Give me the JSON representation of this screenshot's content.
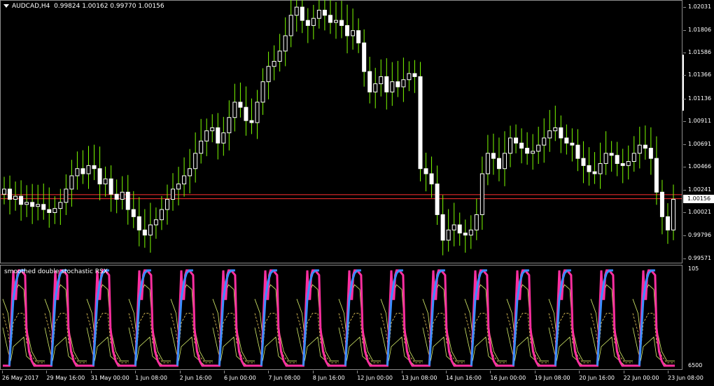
{
  "header": {
    "symbol": "AUDCAD,H4",
    "ohlc": "0.99824 1.00162 0.99770 1.00156"
  },
  "price_axis": {
    "labels": [
      "1.02031",
      "1.01806",
      "1.01586",
      "1.01366",
      "1.01136",
      "1.00911",
      "1.00691",
      "1.00466",
      "1.00241",
      "1.00021",
      "0.99796",
      "0.99571"
    ],
    "current": "1.00156",
    "current_value": 1.00156,
    "red_line_value": 1.00195
  },
  "indicator": {
    "name": "smoothed double stochastic RSX",
    "level_top": "105",
    "level_bottom": "-5",
    "level_bottom_label": "6500"
  },
  "time_axis": {
    "labels": [
      "26 May 2017",
      "29 May 16:00",
      "31 May 00:00",
      "1 Jun 08:00",
      "2 Jun 16:00",
      "6 Jun 00:00",
      "7 Jun 08:00",
      "8 Jun 16:00",
      "12 Jun 00:00",
      "13 Jun 08:00",
      "14 Jun 16:00",
      "16 Jun 00:00",
      "19 Jun 08:00",
      "20 Jun 16:00",
      "22 Jun 00:00",
      "23 Jun 08:00"
    ]
  },
  "colors": {
    "background": "#000000",
    "bull_candle": "#ffffff",
    "bear_candle": "#ffffff",
    "wick": "#7cfc00",
    "current_line": "#ff3030",
    "blue_line": "#3a8eff",
    "pink_line": "#ff2fa0",
    "band_line": "#d8f06a",
    "mid_dash": "#f0d060"
  },
  "chart_data": {
    "type": "candlestick",
    "x_range": [
      0,
      120
    ],
    "ylim": [
      0.99571,
      1.02031
    ],
    "open": [
      1.002,
      1.0025,
      1.0015,
      1.0018,
      1.001,
      1.0012,
      1.0008,
      1.001,
      1.0005,
      1.0002,
      1.0006,
      1.0012,
      1.0025,
      1.0038,
      1.0045,
      1.004,
      1.0048,
      1.0045,
      1.003,
      1.0035,
      1.002,
      1.0015,
      1.0022,
      1.0005,
      0.9998,
      0.9985,
      0.998,
      0.999,
      0.9995,
      1.0005,
      1.0015,
      1.0025,
      1.003,
      1.0038,
      1.0045,
      1.006,
      1.0072,
      1.0082,
      1.0085,
      1.007,
      1.008,
      1.0095,
      1.011,
      1.0105,
      1.0092,
      1.009,
      1.011,
      1.013,
      1.0145,
      1.015,
      1.016,
      1.0175,
      1.0195,
      1.0203,
      1.019,
      1.0185,
      1.0192,
      1.02,
      1.0195,
      1.0188,
      1.019,
      1.0185,
      1.0175,
      1.018,
      1.0168,
      1.014,
      1.012,
      1.0128,
      1.0135,
      1.012,
      1.013,
      1.0125,
      1.0132,
      1.0138,
      1.0135,
      1.0045,
      1.004,
      1.003,
      1.0,
      0.9975,
      0.9985,
      0.999,
      0.9982,
      0.998,
      0.9985,
      1.0,
      1.004,
      1.006,
      1.0055,
      1.0045,
      1.006,
      1.0075,
      1.007,
      1.0065,
      1.006,
      1.0062,
      1.0068,
      1.0075,
      1.0082,
      1.0085,
      1.0075,
      1.007,
      1.0068,
      1.0055,
      1.0048,
      1.0042,
      1.004,
      1.005,
      1.006,
      1.0058,
      1.005,
      1.0048,
      1.0052,
      1.006,
      1.0068,
      1.0065,
      1.0055,
      1.0022,
      0.9998,
      0.9985
    ],
    "close": [
      1.0025,
      1.0015,
      1.0018,
      1.001,
      1.0012,
      1.0008,
      1.001,
      1.0005,
      1.0002,
      1.0006,
      1.0012,
      1.0025,
      1.0038,
      1.0045,
      1.004,
      1.0048,
      1.0045,
      1.003,
      1.0035,
      1.002,
      1.0015,
      1.0022,
      1.0005,
      0.9998,
      0.9985,
      0.998,
      0.999,
      0.9995,
      1.0005,
      1.0015,
      1.0025,
      1.003,
      1.0038,
      1.0045,
      1.006,
      1.0072,
      1.0082,
      1.0085,
      1.007,
      1.008,
      1.0095,
      1.011,
      1.0105,
      1.0092,
      1.009,
      1.011,
      1.013,
      1.0145,
      1.015,
      1.016,
      1.0175,
      1.0195,
      1.0203,
      1.019,
      1.0185,
      1.0192,
      1.02,
      1.0195,
      1.0188,
      1.019,
      1.0185,
      1.0175,
      1.018,
      1.0168,
      1.014,
      1.012,
      1.0128,
      1.0135,
      1.012,
      1.013,
      1.0125,
      1.0132,
      1.0138,
      1.0135,
      1.0045,
      1.004,
      1.003,
      1.0,
      0.9975,
      0.9985,
      0.999,
      0.9982,
      0.998,
      0.9985,
      1.0,
      1.004,
      1.006,
      1.0055,
      1.0045,
      1.006,
      1.0075,
      1.007,
      1.0065,
      1.006,
      1.0062,
      1.0068,
      1.0075,
      1.0082,
      1.0085,
      1.0075,
      1.007,
      1.0068,
      1.0055,
      1.0048,
      1.0042,
      1.004,
      1.005,
      1.006,
      1.0058,
      1.005,
      1.0048,
      1.0052,
      1.006,
      1.0068,
      1.0065,
      1.0055,
      1.0022,
      0.9998,
      0.9985,
      1.0015
    ],
    "indicator_series": {
      "blue": [
        [
          5,
          0
        ],
        [
          8,
          70
        ],
        [
          10,
          88
        ],
        [
          12,
          97
        ],
        [
          14,
          100
        ],
        [
          16,
          100
        ],
        [
          17,
          100
        ]
      ],
      "pink": [
        [
          0,
          0
        ],
        [
          2,
          0
        ],
        [
          3,
          0
        ],
        [
          5,
          0
        ],
        [
          8,
          100
        ],
        [
          9,
          70
        ],
        [
          10,
          70
        ],
        [
          11,
          95
        ],
        [
          12,
          100
        ],
        [
          14,
          100
        ],
        [
          17,
          95
        ],
        [
          18,
          40
        ],
        [
          20,
          15
        ],
        [
          22,
          5
        ],
        [
          24,
          0
        ],
        [
          30,
          0
        ],
        [
          32,
          0
        ]
      ],
      "band_upper": [
        [
          0,
          70
        ],
        [
          4,
          55
        ],
        [
          6,
          30
        ],
        [
          8,
          70
        ],
        [
          12,
          85
        ],
        [
          16,
          80
        ],
        [
          18,
          40
        ],
        [
          22,
          15
        ],
        [
          26,
          5
        ],
        [
          32,
          5
        ]
      ],
      "band_lower": [
        [
          0,
          40
        ],
        [
          4,
          15
        ],
        [
          6,
          5
        ],
        [
          8,
          20
        ],
        [
          12,
          25
        ],
        [
          16,
          30
        ],
        [
          18,
          10
        ],
        [
          22,
          5
        ],
        [
          26,
          0
        ],
        [
          32,
          0
        ]
      ],
      "mid_dash": [
        [
          0,
          55
        ],
        [
          4,
          35
        ],
        [
          6,
          15
        ],
        [
          8,
          45
        ],
        [
          12,
          55
        ],
        [
          16,
          55
        ],
        [
          18,
          25
        ],
        [
          22,
          10
        ],
        [
          26,
          3
        ],
        [
          32,
          3
        ]
      ]
    }
  }
}
